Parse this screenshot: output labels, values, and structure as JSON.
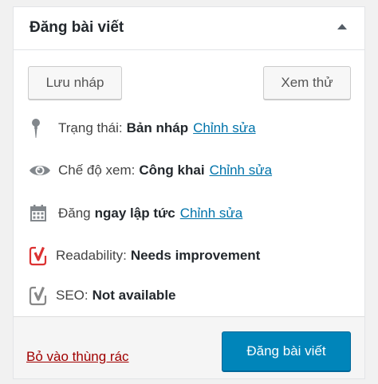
{
  "panel": {
    "title": "Đăng bài viết"
  },
  "actions": {
    "save_draft_label": "Lưu nháp",
    "preview_label": "Xem thử"
  },
  "status": {
    "label": "Trạng thái:",
    "value": "Bản nháp",
    "edit_label": "Chỉnh sửa"
  },
  "visibility": {
    "label": "Chế độ xem:",
    "value": "Công khai",
    "edit_label": "Chỉnh sửa"
  },
  "schedule": {
    "label": "Đăng",
    "value": "ngay lập tức",
    "edit_label": "Chỉnh sửa"
  },
  "readability": {
    "label": "Readability:",
    "value": "Needs improvement",
    "icon": "yoast-icon",
    "color": "#dc3232"
  },
  "seo": {
    "label": "SEO:",
    "value": "Not available",
    "icon": "yoast-icon",
    "color": "#888888"
  },
  "footer": {
    "trash_label": "Bỏ vào thùng rác",
    "publish_label": "Đăng bài viết"
  },
  "colors": {
    "link": "#0073aa",
    "trash": "#a00000",
    "publish_bg": "#0085ba"
  }
}
